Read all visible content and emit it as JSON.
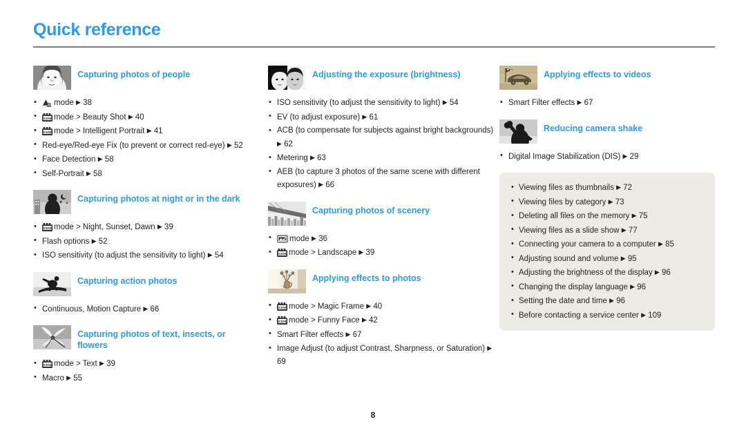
{
  "header": {
    "title": "Quick reference"
  },
  "footer": {
    "page_number": "8"
  },
  "colors": {
    "heading_blue": "#2b9bf0",
    "rule_gray": "#7d7d7d",
    "infobox_bg": "#eeebe6",
    "text": "#231f20"
  },
  "columns": [
    {
      "name": "column-1",
      "sections": [
        {
          "title": "Capturing photos of people",
          "thumb": "portrait-woman-thumbnail",
          "items": [
            {
              "icon": "smart-auto-mode-icon",
              "text": "mode",
              "arrow": "▶",
              "page": "38"
            },
            {
              "icon": "scene-mode-icon",
              "text": "mode > Beauty Shot",
              "arrow": "▶",
              "page": "40"
            },
            {
              "icon": "scene-mode-icon",
              "text": "mode > Intelligent Portrait",
              "arrow": "▶",
              "page": "41"
            },
            {
              "icon": null,
              "text": "Red-eye/Red-eye Fix (to prevent or correct red-eye)",
              "arrow": "▶",
              "page": "52"
            },
            {
              "icon": null,
              "text": "Face Detection",
              "arrow": "▶",
              "page": "58"
            },
            {
              "icon": null,
              "text": "Self-Portrait",
              "arrow": "▶",
              "page": "58"
            }
          ]
        },
        {
          "title": "Capturing photos at night or in the dark",
          "thumb": "night-city-silhouette-thumbnail",
          "items": [
            {
              "icon": "scene-mode-icon",
              "text": "mode > Night, Sunset, Dawn",
              "arrow": "▶",
              "page": "39"
            },
            {
              "icon": null,
              "text": "Flash options",
              "arrow": "▶",
              "page": "52"
            },
            {
              "icon": null,
              "text": "ISO sensitivity (to adjust the sensitivity to light)",
              "arrow": "▶",
              "page": "54"
            }
          ]
        },
        {
          "title": "Capturing action photos",
          "thumb": "snowboarder-thumbnail",
          "items": [
            {
              "icon": null,
              "text": "Continuous, Motion Capture",
              "arrow": "▶",
              "page": "66"
            }
          ]
        },
        {
          "title": "Capturing photos of text, insects, or flowers",
          "thumb": "flower-macro-thumbnail",
          "items": [
            {
              "icon": "scene-mode-icon",
              "text": "mode > Text",
              "arrow": "▶",
              "page": "39"
            },
            {
              "icon": null,
              "text": "Macro",
              "arrow": "▶",
              "page": "55"
            }
          ]
        }
      ]
    },
    {
      "name": "column-2",
      "sections": [
        {
          "title": "Adjusting the exposure (brightness)",
          "thumb": "two-faces-contrast-thumbnail",
          "items": [
            {
              "icon": null,
              "text": "ISO sensitivity (to adjust the sensitivity to light)",
              "arrow": "▶",
              "page": "54"
            },
            {
              "icon": null,
              "text": "EV (to adjust exposure)",
              "arrow": "▶",
              "page": "61"
            },
            {
              "icon": null,
              "text": "ACB (to compensate for subjects against bright backgrounds)",
              "arrow": "▶",
              "page": "62"
            },
            {
              "icon": null,
              "text": "Metering",
              "arrow": "▶",
              "page": "63"
            },
            {
              "icon": null,
              "text": "AEB (to capture 3 photos of the same scene with different exposures)",
              "arrow": "▶",
              "page": "66"
            }
          ]
        },
        {
          "title": "Capturing photos of scenery",
          "thumb": "bridge-cityscape-thumbnail",
          "items": [
            {
              "icon": "landscape-mode-icon",
              "text": "mode",
              "arrow": "▶",
              "page": "36"
            },
            {
              "icon": "scene-mode-icon",
              "text": "mode > Landscape",
              "arrow": "▶",
              "page": "39"
            }
          ]
        },
        {
          "title": "Applying effects to photos",
          "thumb": "vase-flowers-sepia-thumbnail",
          "items": [
            {
              "icon": "scene-mode-icon",
              "text": "mode > Magic Frame",
              "arrow": "▶",
              "page": "40"
            },
            {
              "icon": "scene-mode-icon",
              "text": "mode > Funny Face",
              "arrow": "▶",
              "page": "42"
            },
            {
              "icon": null,
              "text": "Smart Filter effects",
              "arrow": "▶",
              "page": "67"
            },
            {
              "icon": null,
              "text": "Image Adjust (to adjust Contrast, Sharpness, or Saturation)",
              "arrow": "▶",
              "page": "69"
            }
          ]
        }
      ]
    },
    {
      "name": "column-3",
      "sections": [
        {
          "title": "Applying effects to videos",
          "thumb": "toy-car-flag-sepia-thumbnail",
          "items": [
            {
              "icon": null,
              "text": "Smart Filter effects",
              "arrow": "▶",
              "page": "67"
            }
          ]
        },
        {
          "title": "Reducing camera shake",
          "thumb": "person-waving-thumbnail",
          "items": [
            {
              "icon": null,
              "text": "Digital Image Stabilization (DIS)",
              "arrow": "▶",
              "page": "29"
            }
          ]
        }
      ],
      "infobox": {
        "name": "general-tips-box",
        "items": [
          {
            "text": "Viewing files as thumbnails",
            "arrow": "▶",
            "page": "72"
          },
          {
            "text": "Viewing files by category",
            "arrow": "▶",
            "page": "73"
          },
          {
            "text": "Deleting all files on the memory",
            "arrow": "▶",
            "page": "75"
          },
          {
            "text": "Viewing files as a slide show",
            "arrow": "▶",
            "page": "77"
          },
          {
            "text": "Connecting your camera to a computer",
            "arrow": "▶",
            "page": "85"
          },
          {
            "text": "Adjusting sound and volume",
            "arrow": "▶",
            "page": "95"
          },
          {
            "text": "Adjusting the brightness of the display",
            "arrow": "▶",
            "page": "96"
          },
          {
            "text": "Changing the display language",
            "arrow": "▶",
            "page": "96"
          },
          {
            "text": "Setting the date and time",
            "arrow": "▶",
            "page": "96"
          },
          {
            "text": "Before contacting a service center",
            "arrow": "▶",
            "page": "109"
          }
        ]
      }
    }
  ]
}
